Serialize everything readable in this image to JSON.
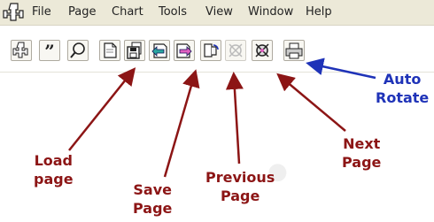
{
  "menubar": {
    "items": [
      {
        "label": "File"
      },
      {
        "label": "Page"
      },
      {
        "label": "Chart"
      },
      {
        "label": "Tools"
      },
      {
        "label": "View"
      },
      {
        "label": "Window"
      },
      {
        "label": "Help"
      }
    ]
  },
  "toolbar": {
    "buttons": [
      {
        "name": "app-key-icon"
      },
      {
        "name": "quote-icon"
      },
      {
        "name": "magnifier-icon"
      },
      {
        "name": "new-page-icon"
      },
      {
        "name": "save-page-icon"
      },
      {
        "name": "previous-page-icon"
      },
      {
        "name": "next-page-icon"
      },
      {
        "name": "auto-rotate-icon"
      },
      {
        "name": "disabled-wheel-icon"
      },
      {
        "name": "wheel-icon"
      },
      {
        "name": "printer-icon"
      }
    ]
  },
  "callouts": {
    "load_page": [
      "Load",
      "page"
    ],
    "save_page": [
      "Save",
      "Page"
    ],
    "previous_page": [
      "Previous",
      "Page"
    ],
    "next_page": [
      "Next",
      "Page"
    ],
    "auto_rotate": [
      "Auto",
      "Rotate"
    ]
  },
  "colors": {
    "callout_red": "#8c1515",
    "callout_blue": "#1f33b8",
    "menubar_bg": "#ece9d8"
  }
}
